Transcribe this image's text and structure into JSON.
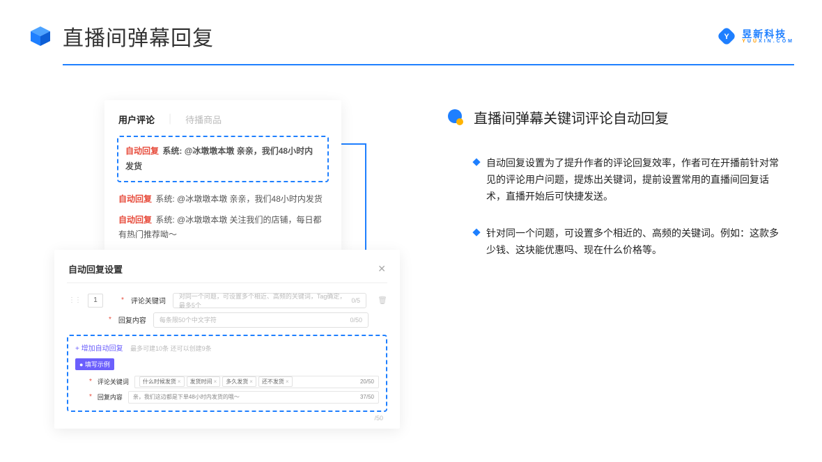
{
  "header": {
    "title": "直播间弹幕回复",
    "brand_cn": "昱新科技",
    "brand_en": "YUUXIN.COM"
  },
  "comments_card": {
    "tab_active": "用户评论",
    "tab_inactive": "待播商品",
    "auto_tag": "自动回复",
    "highlighted": "系统: @冰墩墩本墩 亲亲，我们48小时内发货",
    "line2": "系统: @冰墩墩本墩 亲亲，我们48小时内发货",
    "line3": "系统: @冰墩墩本墩 关注我们的店铺，每日都有热门推荐呦～"
  },
  "settings_card": {
    "title": "自动回复设置",
    "row_num": "1",
    "label_keyword": "评论关键词",
    "placeholder_keyword": "对同一个问题，可设置多个相近、高频的关键词，Tag确定，最多5个",
    "count_keyword": "0/5",
    "label_content": "回复内容",
    "placeholder_content": "每条限50个中文字符",
    "count_content": "0/50",
    "add_link": "+ 增加自动回复",
    "add_hint": "最多可建10条 还可以创建9条",
    "badge": "● 填写示例",
    "ex_label_kw": "评论关键词",
    "ex_tags": [
      "什么时候发货",
      "发货时间",
      "多久发货",
      "还不发货"
    ],
    "ex_count_kw": "20/50",
    "ex_label_ct": "回复内容",
    "ex_content": "亲，我们这边都是下单48小时内发货的哦～",
    "ex_count_ct": "37/50",
    "footer_count": "/50"
  },
  "right": {
    "section_title": "直播间弹幕关键词评论自动回复",
    "bullet1": "自动回复设置为了提升作者的评论回复效率，作者可在开播前针对常见的评论用户问题，提炼出关键词，提前设置常用的直播间回复话术，直播开始后可快捷发送。",
    "bullet2": "针对同一个问题，可设置多个相近的、高频的关键词。例如：这款多少钱、这块能优惠吗、现在什么价格等。"
  }
}
